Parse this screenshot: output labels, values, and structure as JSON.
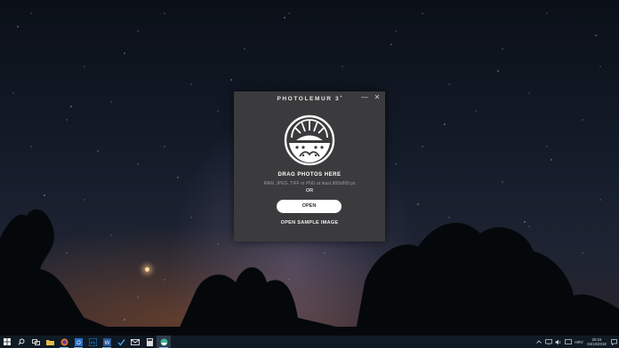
{
  "dialog": {
    "title": "PHOTOLEMUR 3",
    "title_badge": "+",
    "minimize_label": "—",
    "close_label": "✕",
    "logo_icon": "photolemur-logo-icon",
    "drag_title": "DRAG PHOTOS HERE",
    "formats": "RAW, JPEG, TIFF or PNG at least 800x800 px",
    "or_text": "OR",
    "open_button": "OPEN",
    "sample_link": "OPEN SAMPLE IMAGE"
  },
  "taskbar": {
    "apps": [
      {
        "name": "start-icon",
        "color": "#ffffff"
      },
      {
        "name": "search-icon",
        "color": "#ffffff"
      },
      {
        "name": "task-view-icon",
        "color": "#ffffff"
      },
      {
        "name": "file-explorer-icon",
        "color": "#e8b84a"
      },
      {
        "name": "firefox-icon",
        "color": "#e8732d"
      },
      {
        "name": "outlook-icon",
        "color": "#2a71c8"
      },
      {
        "name": "photoshop-icon",
        "color": "#2fa3f0"
      },
      {
        "name": "word-icon",
        "color": "#2b5797"
      },
      {
        "name": "todo-icon",
        "color": "#4a9ae0"
      },
      {
        "name": "mail-icon",
        "color": "#ffffff"
      },
      {
        "name": "calculator-icon",
        "color": "#dddddd"
      },
      {
        "name": "photolemur-icon",
        "color": "#3fb89a"
      }
    ],
    "language": "HRV",
    "time": "20:15",
    "date": "04/10/2018"
  },
  "colors": {
    "dialog_bg": "#3b3b3d",
    "taskbar_bg": "#0f1a24",
    "accent": "#3fb89a"
  }
}
